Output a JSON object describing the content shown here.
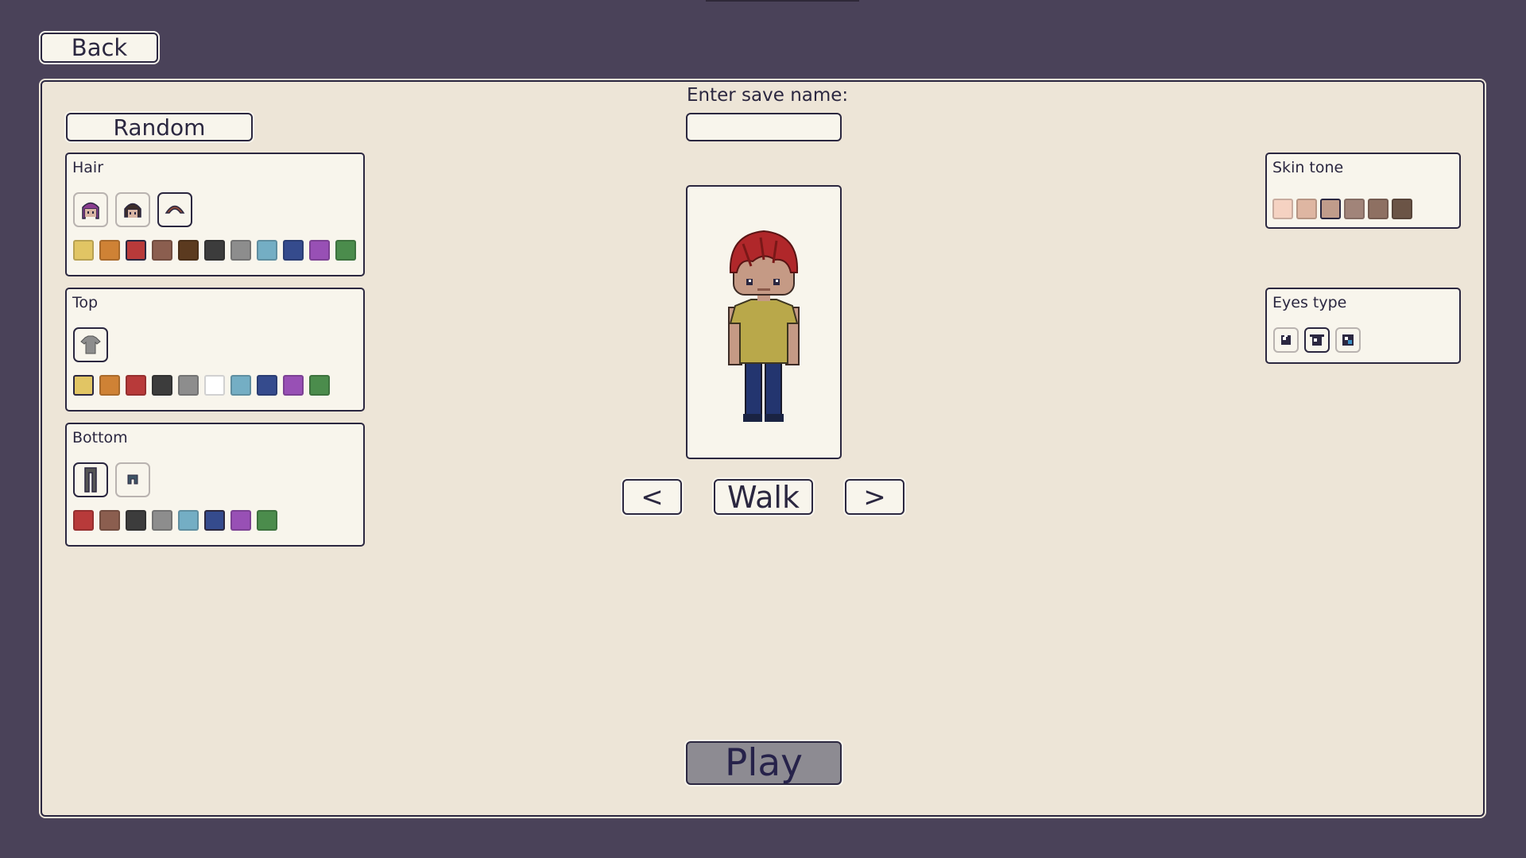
{
  "back_label": "Back",
  "random_label": "Random",
  "save": {
    "label": "Enter save name:",
    "value": "",
    "placeholder": ""
  },
  "nav": {
    "prev_label": "<",
    "animation_label": "Walk",
    "next_label": ">"
  },
  "play_label": "Play",
  "hair": {
    "title": "Hair",
    "styles": [
      "pigtails-hair-icon",
      "bob-hair-icon",
      "short-hair-icon"
    ],
    "selected_style": 2,
    "colors": [
      "#e1c564",
      "#cf8235",
      "#b83a3a",
      "#8b5e4f",
      "#5b3a1f",
      "#3c3c3c",
      "#8d8d8d",
      "#74aec4",
      "#354b8d",
      "#9850b5",
      "#4b8c4c"
    ],
    "selected_color": 2
  },
  "top": {
    "title": "Top",
    "styles": [
      "tshirt-icon"
    ],
    "selected_style": 0,
    "colors": [
      "#e1c564",
      "#cf8235",
      "#b83a3a",
      "#3c3c3c",
      "#8d8d8d",
      "#ffffff",
      "#74aec4",
      "#354b8d",
      "#9850b5",
      "#4b8c4c"
    ],
    "selected_color": 0
  },
  "bottom": {
    "title": "Bottom",
    "styles": [
      "long-pants-icon",
      "shorts-icon"
    ],
    "selected_style": 0,
    "colors": [
      "#b83a3a",
      "#8b5e4f",
      "#3c3c3c",
      "#8d8d8d",
      "#74aec4",
      "#354b8d",
      "#9850b5",
      "#4b8c4c"
    ],
    "selected_color": 5
  },
  "skin": {
    "title": "Skin tone",
    "colors": [
      "#f5d2c2",
      "#deb6a2",
      "#c09c8b",
      "#a18479",
      "#8e7062",
      "#6b5446"
    ],
    "selected_color": 2
  },
  "eyes": {
    "title": "Eyes type",
    "styles": [
      "eyes-type-1-icon",
      "eyes-type-2-icon",
      "eyes-type-3-icon"
    ],
    "selected_style": 1
  },
  "colors": {
    "background": "#4a4259",
    "panel": "#ede5d7",
    "box": "#f8f5ec",
    "border": "#2b2740",
    "play_button": "#8d8b92"
  }
}
